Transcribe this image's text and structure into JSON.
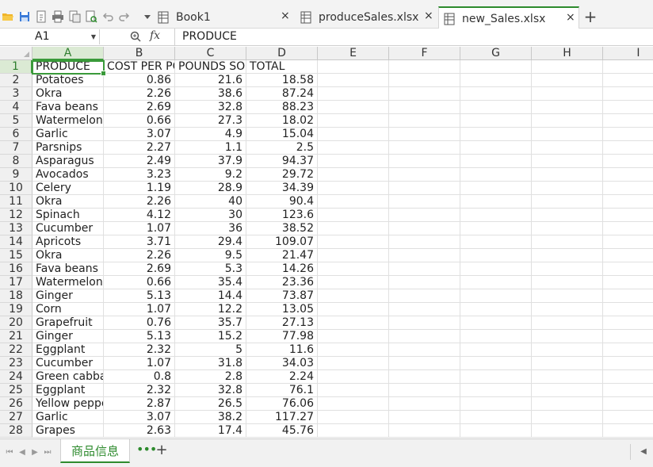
{
  "toolbar": {
    "icons": [
      "folder-open-icon",
      "save-icon",
      "export-icon",
      "print-icon",
      "print-preview-icon",
      "check-icon",
      "undo-icon",
      "redo-icon",
      "dropdown-icon"
    ]
  },
  "tabs": [
    {
      "label": "Book1",
      "active": false
    },
    {
      "label": "produceSales.xlsx",
      "active": false
    },
    {
      "label": "new_Sales.xlsx",
      "active": true
    }
  ],
  "tab_close_glyph": "×",
  "add_tab_glyph": "+",
  "formula_bar": {
    "name_box": "A1",
    "fx_label": "fx",
    "content": "PRODUCE"
  },
  "columns": [
    "A",
    "B",
    "C",
    "D",
    "E",
    "F",
    "G",
    "H",
    "I"
  ],
  "header_row": [
    "PRODUCE",
    "COST PER POUND",
    "POUNDS SOLD",
    "TOTAL"
  ],
  "rows": [
    [
      "Potatoes",
      "0.86",
      "21.6",
      "18.58"
    ],
    [
      "Okra",
      "2.26",
      "38.6",
      "87.24"
    ],
    [
      "Fava beans",
      "2.69",
      "32.8",
      "88.23"
    ],
    [
      "Watermelon",
      "0.66",
      "27.3",
      "18.02"
    ],
    [
      "Garlic",
      "3.07",
      "4.9",
      "15.04"
    ],
    [
      "Parsnips",
      "2.27",
      "1.1",
      "2.5"
    ],
    [
      "Asparagus",
      "2.49",
      "37.9",
      "94.37"
    ],
    [
      "Avocados",
      "3.23",
      "9.2",
      "29.72"
    ],
    [
      "Celery",
      "1.19",
      "28.9",
      "34.39"
    ],
    [
      "Okra",
      "2.26",
      "40",
      "90.4"
    ],
    [
      "Spinach",
      "4.12",
      "30",
      "123.6"
    ],
    [
      "Cucumber",
      "1.07",
      "36",
      "38.52"
    ],
    [
      "Apricots",
      "3.71",
      "29.4",
      "109.07"
    ],
    [
      "Okra",
      "2.26",
      "9.5",
      "21.47"
    ],
    [
      "Fava beans",
      "2.69",
      "5.3",
      "14.26"
    ],
    [
      "Watermelon",
      "0.66",
      "35.4",
      "23.36"
    ],
    [
      "Ginger",
      "5.13",
      "14.4",
      "73.87"
    ],
    [
      "Corn",
      "1.07",
      "12.2",
      "13.05"
    ],
    [
      "Grapefruit",
      "0.76",
      "35.7",
      "27.13"
    ],
    [
      "Ginger",
      "5.13",
      "15.2",
      "77.98"
    ],
    [
      "Eggplant",
      "2.32",
      "5",
      "11.6"
    ],
    [
      "Cucumber",
      "1.07",
      "31.8",
      "34.03"
    ],
    [
      "Green cabbage",
      "0.8",
      "2.8",
      "2.24"
    ],
    [
      "Eggplant",
      "2.32",
      "32.8",
      "76.1"
    ],
    [
      "Yellow peppers",
      "2.87",
      "26.5",
      "76.06"
    ],
    [
      "Garlic",
      "3.07",
      "38.2",
      "117.27"
    ],
    [
      "Grapes",
      "2.63",
      "17.4",
      "45.76"
    ]
  ],
  "sheet": {
    "name": "商品信息",
    "more_glyph": "•••",
    "add_glyph": "+"
  }
}
